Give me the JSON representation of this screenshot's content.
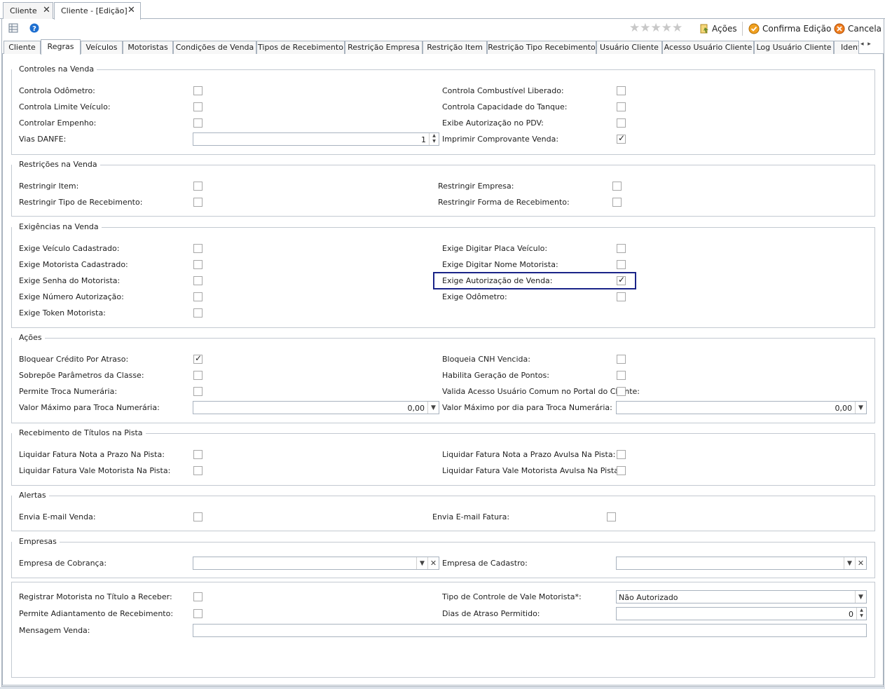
{
  "doc_tabs": [
    {
      "label": "Cliente",
      "active": false
    },
    {
      "label": "Cliente - [Edição]",
      "active": true
    }
  ],
  "toolbar": {
    "actions_label": "Ações",
    "confirm_label": "Confirma Edição",
    "cancel_label": "Cancela",
    "stars": "★★★★★",
    "accent_colors": {
      "confirm": "#f0a020",
      "cancel": "#f08020",
      "help": "#1e6fd0"
    }
  },
  "section_tabs": [
    "Cliente",
    "Regras",
    "Veículos",
    "Motoristas",
    "Condições de Venda",
    "Tipos de Recebimento",
    "Restrição Empresa",
    "Restrição Item",
    "Restrição Tipo Recebimento",
    "Usuário Cliente",
    "Acesso Usuário Cliente",
    "Log Usuário Cliente",
    "Identi"
  ],
  "active_tab": "Regras",
  "groups": {
    "controles": {
      "title": "Controles na Venda",
      "odometro": "Controla Odômetro:",
      "limite_veiculo": "Controla Limite Veículo:",
      "empenho": "Controlar Empenho:",
      "vias_danfe": "Vias DANFE:",
      "vias_danfe_value": "1",
      "combustivel": "Controla Combustível Liberado:",
      "capacidade": "Controla Capacidade do Tanque:",
      "exibe_autorizacao": "Exibe Autorização no PDV:",
      "imprimir_comprovante": "Imprimir Comprovante Venda:"
    },
    "restricoes": {
      "title": "Restrições na Venda",
      "item": "Restringir Item:",
      "tipo_recebimento": "Restringir Tipo de Recebimento:",
      "empresa": "Restringir Empresa:",
      "forma_recebimento": "Restringir Forma de Recebimento:"
    },
    "exigencias": {
      "title": "Exigências na Venda",
      "veiculo_cadastrado": "Exige Veículo Cadastrado:",
      "motorista_cadastrado": "Exige Motorista Cadastrado:",
      "senha_motorista": "Exige Senha do Motorista:",
      "numero_autorizacao": "Exige Número Autorização:",
      "token_motorista": "Exige Token Motorista:",
      "placa_veiculo": "Exige Digitar Placa Veículo:",
      "nome_motorista": "Exige Digitar Nome Motorista:",
      "autorizacao_venda": "Exige Autorização de Venda:",
      "odometro": "Exige Odômetro:"
    },
    "acoes": {
      "title": "Ações",
      "bloquear_credito": "Bloquear Crédito Por Atraso:",
      "sobrepoe": "Sobrepõe Parâmetros da Classe:",
      "troca_numeraria": "Permite Troca Numerária:",
      "valor_maximo": "Valor Máximo para Troca Numerária:",
      "valor_maximo_value": "0,00",
      "bloqueia_cnh": "Bloqueia CNH Vencida:",
      "geracao_pontos": "Habilita Geração de Pontos:",
      "valida_acesso": "Valida Acesso Usuário Comum no Portal do Cliente:",
      "valor_maximo_dia": "Valor Máximo por dia para Troca Numerária:",
      "valor_maximo_dia_value": "0,00"
    },
    "recebimento": {
      "title": "Recebimento de Títulos na Pista",
      "fatura_prazo": "Liquidar Fatura Nota a Prazo Na Pista:",
      "fatura_vale": "Liquidar Fatura Vale Motorista Na Pista:",
      "fatura_prazo_avulsa": "Liquidar Fatura Nota a Prazo Avulsa Na Pista:",
      "fatura_vale_avulsa": "Liquidar Fatura Vale Motorista Avulsa Na Pista:"
    },
    "alertas": {
      "title": "Alertas",
      "email_venda": "Envia E-mail Venda:",
      "email_fatura": "Envia E-mail Fatura:"
    },
    "empresas": {
      "title": "Empresas",
      "cobranca": "Empresa de Cobrança:",
      "cadastro": "Empresa de Cadastro:"
    },
    "outros": {
      "registrar_motorista": "Registrar Motorista no Título a Receber:",
      "adiantamento": "Permite Adiantamento de Recebimento:",
      "mensagem_venda": "Mensagem Venda:",
      "tipo_controle_vale": "Tipo de Controle de Vale Motorista*:",
      "tipo_controle_vale_value": "Não Autorizado",
      "dias_atraso": "Dias de Atraso Permitido:",
      "dias_atraso_value": "0"
    }
  },
  "checked": {
    "imprimir_comprovante": true,
    "autorizacao_venda": true,
    "bloquear_credito": true
  },
  "highlight_color": "#1a2488"
}
